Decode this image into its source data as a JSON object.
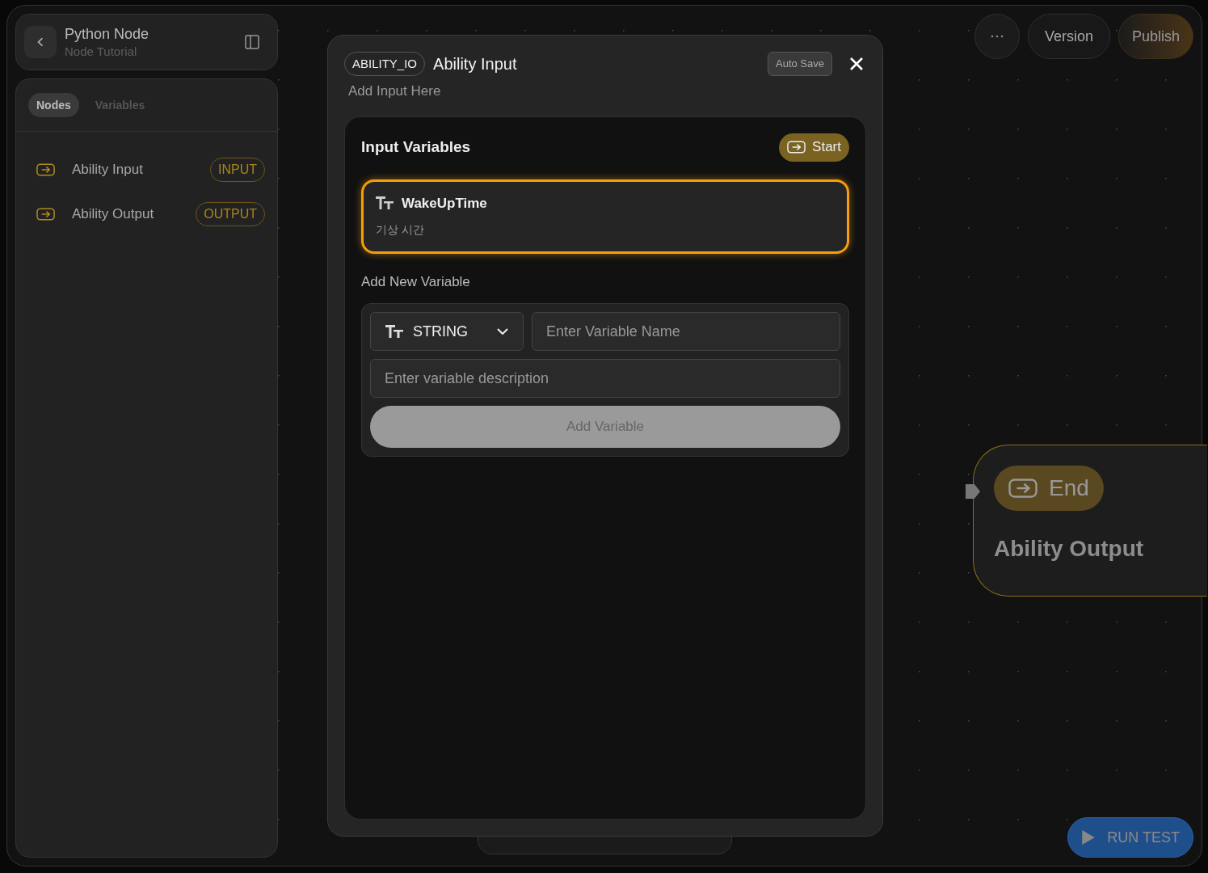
{
  "sidebar": {
    "title": "Python Node",
    "subtitle": "Node Tutorial",
    "tabs": [
      {
        "label": "Nodes",
        "selected": true
      },
      {
        "label": "Variables",
        "selected": false
      }
    ],
    "items": [
      {
        "label": "Ability Input",
        "badge": "INPUT"
      },
      {
        "label": "Ability Output",
        "badge": "OUTPUT"
      }
    ]
  },
  "top_actions": [
    {
      "label": "Version",
      "kind": "plain"
    },
    {
      "label": "Publish",
      "kind": "accent"
    }
  ],
  "end_node": {
    "badge": "End",
    "title": "Ability Output"
  },
  "run_button": {
    "label": "RUN TEST"
  },
  "modal": {
    "tag": "ABILITY_IO",
    "title": "Ability Input",
    "subtitle": "Add Input Here",
    "auto_save": "Auto Save",
    "section_title": "Input Variables",
    "section_badge": "Start",
    "variables": [
      {
        "name": "WakeUpTime",
        "description": "기상 시간",
        "selected": true
      }
    ],
    "add_title": "Add New Variable",
    "type_select": {
      "value": "STRING"
    },
    "name_field": {
      "placeholder": "Enter Variable Name"
    },
    "desc_field": {
      "placeholder": "Enter variable description"
    },
    "add_button": {
      "label": "Add Variable",
      "disabled": true
    }
  }
}
